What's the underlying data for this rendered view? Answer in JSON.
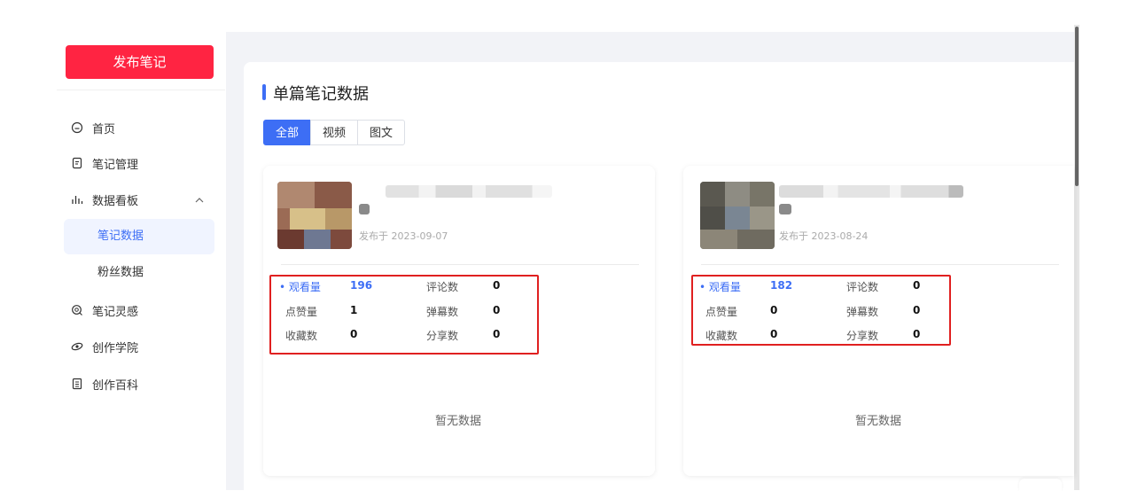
{
  "sidebar": {
    "publish_label": "发布笔记",
    "items": [
      {
        "label": "首页",
        "icon": "home-icon"
      },
      {
        "label": "笔记管理",
        "icon": "note-icon"
      },
      {
        "label": "数据看板",
        "icon": "bar-chart-icon"
      },
      {
        "label": "笔记数据"
      },
      {
        "label": "粉丝数据"
      },
      {
        "label": "笔记灵感",
        "icon": "bulb-icon"
      },
      {
        "label": "创作学院",
        "icon": "academy-icon"
      },
      {
        "label": "创作百科",
        "icon": "book-icon"
      }
    ]
  },
  "main": {
    "title": "单篇笔记数据",
    "tabs": [
      "全部",
      "视频",
      "图文"
    ]
  },
  "cards": [
    {
      "date": "发布于 2023-09-07",
      "stats": {
        "views_label": "• 观看量",
        "views": "196",
        "likes_label": "点赞量",
        "likes": "1",
        "saves_label": "收藏数",
        "saves": "0",
        "comments_label": "评论数",
        "comments": "0",
        "danmu_label": "弹幕数",
        "danmu": "0",
        "shares_label": "分享数",
        "shares": "0"
      },
      "empty_text": "暂无数据"
    },
    {
      "date": "发布于 2023-08-24",
      "stats": {
        "views_label": "• 观看量",
        "views": "182",
        "likes_label": "点赞量",
        "likes": "0",
        "saves_label": "收藏数",
        "saves": "0",
        "comments_label": "评论数",
        "comments": "0",
        "danmu_label": "弹幕数",
        "danmu": "0",
        "shares_label": "分享数",
        "shares": "0"
      },
      "empty_text": "暂无数据"
    }
  ],
  "colors": {
    "brand_red": "#ff2442",
    "accent_blue": "#3d6ef5",
    "highlight_box": "#e02020"
  }
}
